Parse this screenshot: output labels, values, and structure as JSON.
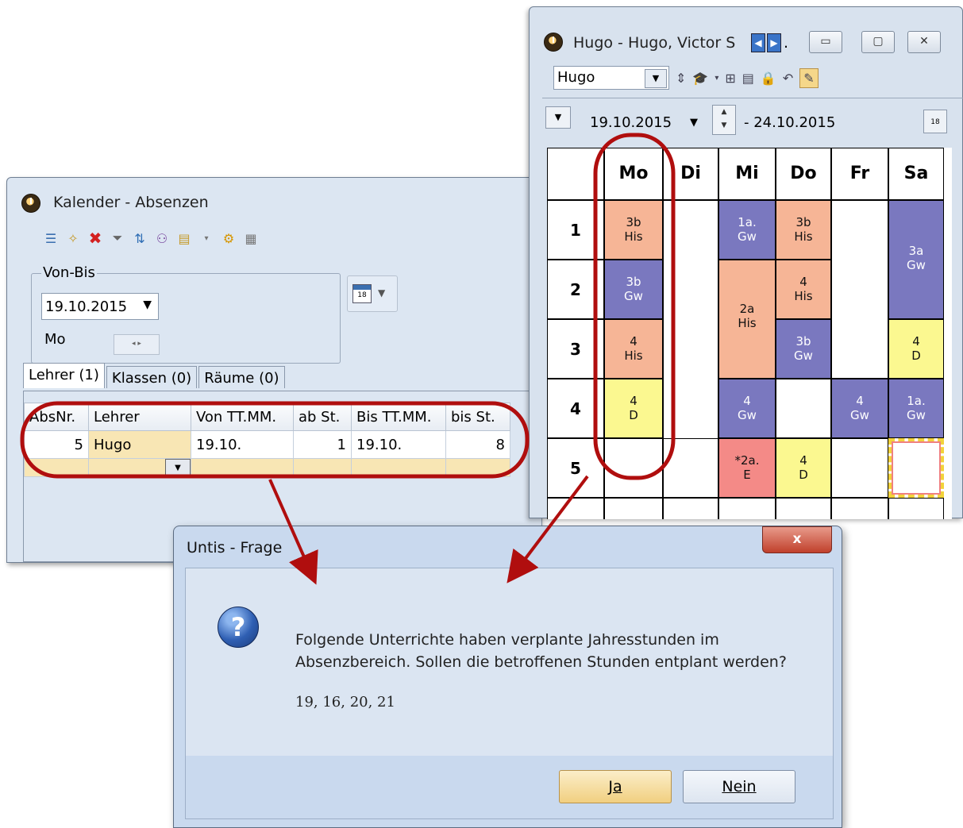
{
  "kalender": {
    "title": "Kalender - Absenzen",
    "von_bis_label": "Von-Bis",
    "date": "19.10.2015",
    "weekday": "Mo",
    "tabs": [
      "Lehrer (1)",
      "Klassen (0)",
      "Räume (0)"
    ],
    "columns": [
      "AbsNr.",
      "Lehrer",
      "Von TT.MM.",
      "ab St.",
      "Bis TT.MM.",
      "bis St."
    ],
    "rows": [
      [
        "5",
        "Hugo",
        "19.10.",
        "1",
        "19.10.",
        "8"
      ]
    ]
  },
  "hugo": {
    "title": "Hugo - Hugo, Victor S",
    "title_ellipsis": ".",
    "combo_value": "Hugo",
    "date_from": "19.10.2015",
    "date_to": "- 24.10.2015",
    "days": [
      "Mo",
      "Di",
      "Mi",
      "Do",
      "Fr",
      "Sa"
    ],
    "periods": [
      "1",
      "2",
      "3",
      "4",
      "5"
    ],
    "lessons": {
      "mo1": [
        "3b",
        "His"
      ],
      "mo2": [
        "3b",
        "Gw"
      ],
      "mo3": [
        "4",
        "His"
      ],
      "mo4": [
        "4",
        "D"
      ],
      "mi1": [
        "1a.",
        "Gw"
      ],
      "mi23": [
        "2a",
        "His"
      ],
      "mi4": [
        "4",
        "Gw"
      ],
      "mi5": [
        "*2a.",
        "E"
      ],
      "do1": [
        "3b",
        "His"
      ],
      "do2": [
        "4",
        "His"
      ],
      "do3": [
        "3b",
        "Gw"
      ],
      "do5": [
        "4",
        "D"
      ],
      "fr4": [
        "4",
        "Gw"
      ],
      "sa12": [
        "3a",
        "Gw"
      ],
      "sa3": [
        "4",
        "D"
      ],
      "sa4": [
        "1a.",
        "Gw"
      ]
    },
    "colors": {
      "purple": "#7a78bf",
      "orange": "#f6b596",
      "yellow": "#fbf890",
      "red": "#f48a87",
      "pink": "#f8cccc"
    }
  },
  "dialog": {
    "title": "Untis - Frage",
    "message_line1": "Folgende Unterrichte haben verplante Jahresstunden im",
    "message_line2": "Absenzbereich. Sollen die betroffenen Stunden entplant werden?",
    "numbers": "19, 16, 20, 21",
    "yes_label": "Ja",
    "no_label": "Nein",
    "close_label": "x"
  },
  "annotation_color": "#b00e0e"
}
